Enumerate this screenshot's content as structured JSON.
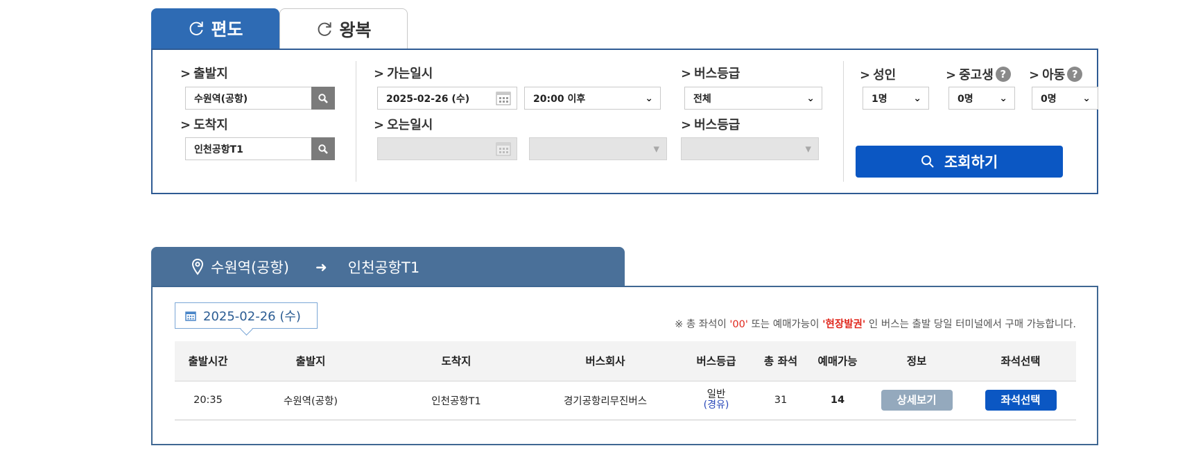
{
  "tabs": {
    "oneway": "편도",
    "roundtrip": "왕복"
  },
  "search": {
    "departure_label": "출발지",
    "departure_value": "수원역(공항)",
    "arrival_label": "도착지",
    "arrival_value": "인천공항T1",
    "go_date_label": "가는일시",
    "go_date_value": "2025-02-26 (수)",
    "go_time_value": "20:00 이후",
    "return_date_label": "오는일시",
    "bus_grade_label": "버스등급",
    "bus_grade_value": "전체",
    "return_bus_grade_label": "버스등급",
    "adult_label": "성인",
    "adult_value": "1명",
    "student_label": "중고생",
    "student_value": "0명",
    "child_label": "아동",
    "child_value": "0명",
    "help_glyph": "?",
    "query_button": "조회하기"
  },
  "result": {
    "route_from": "수원역(공항)",
    "route_to": "인천공항T1",
    "date": "2025-02-26 (수)",
    "notice_prefix": "※ 총 좌석이 ",
    "notice_zero": "'00'",
    "notice_mid": " 또는 예매가능이 ",
    "notice_onsite": "'현장발권'",
    "notice_suffix": " 인 버스는 출발 당일 터미널에서 구매 가능합니다.",
    "columns": [
      "출발시간",
      "출발지",
      "도착지",
      "버스회사",
      "버스등급",
      "총 좌석",
      "예매가능",
      "정보",
      "좌석선택"
    ],
    "rows": [
      {
        "time": "20:35",
        "from": "수원역(공항)",
        "to": "인천공항T1",
        "company": "경기공항리무진버스",
        "grade": "일반",
        "grade_note": "(경유)",
        "total_seats": "31",
        "available": "14",
        "detail_button": "상세보기",
        "seat_button": "좌석선택"
      }
    ]
  },
  "colors": {
    "primary_blue": "#0b57c3",
    "tab_blue": "#2e6bb4",
    "route_header": "#4a7099",
    "notice_red": "#e0261b"
  },
  "icons": {
    "tab": "refresh-icon",
    "search": "magnifier-icon",
    "calendar": "calendar-icon",
    "pin": "location-pin-icon"
  }
}
